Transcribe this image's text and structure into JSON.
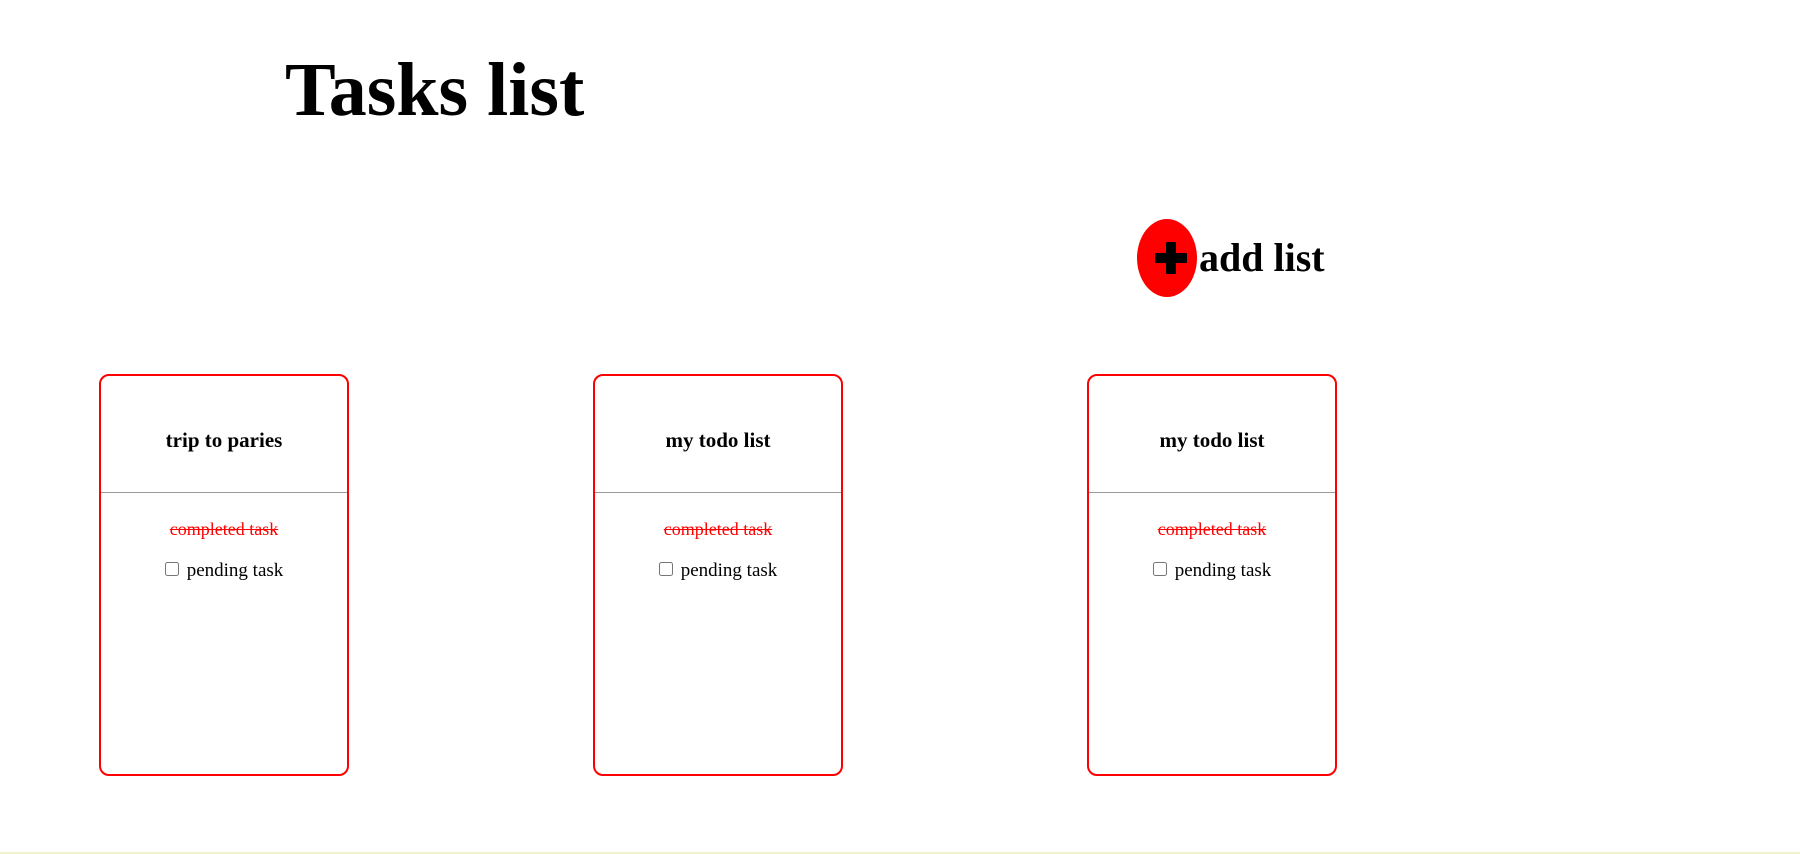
{
  "page": {
    "title": "Tasks list"
  },
  "add_list": {
    "icon": "plus-icon",
    "label": "add list",
    "accent_color": "#ff0000"
  },
  "lists": [
    {
      "title": "trip to paries",
      "completed_task": "completed task",
      "pending_task": "pending task",
      "pending_checked": false
    },
    {
      "title": "my todo list",
      "completed_task": "completed task",
      "pending_task": "pending task",
      "pending_checked": false
    },
    {
      "title": "my todo list",
      "completed_task": "completed task",
      "pending_task": "pending task",
      "pending_checked": false
    }
  ],
  "colors": {
    "card_border": "#ff0000",
    "completed_text": "#ff0000",
    "divider": "#9a9a9a"
  }
}
